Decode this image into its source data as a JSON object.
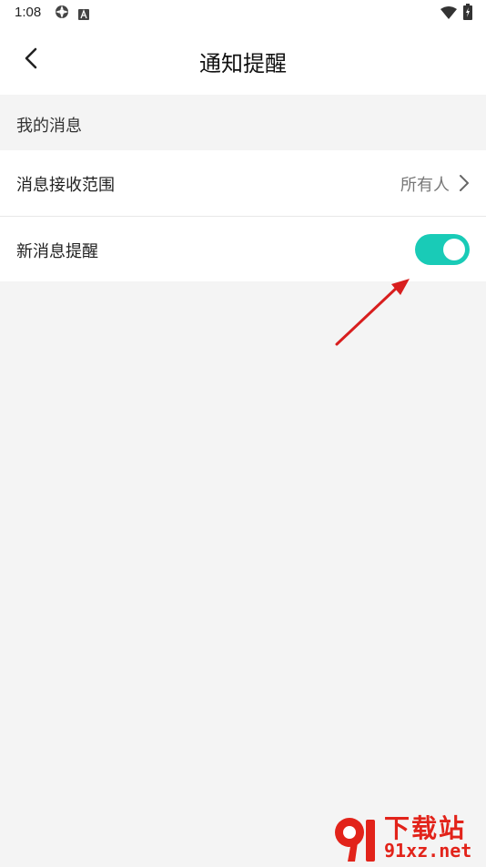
{
  "status_bar": {
    "time": "1:08",
    "icons": [
      "gear-icon",
      "font-icon",
      "wifi-icon",
      "battery-icon"
    ]
  },
  "header": {
    "title": "通知提醒",
    "back_icon": "chevron-left-icon"
  },
  "section": {
    "title": "我的消息"
  },
  "rows": [
    {
      "label": "消息接收范围",
      "value": "所有人",
      "icon": "chevron-right-icon"
    },
    {
      "label": "新消息提醒",
      "toggle_on": true
    }
  ],
  "colors": {
    "toggle_on": "#19cbb7",
    "background": "#f4f4f4",
    "annotation_arrow": "#d81e1e"
  },
  "watermark": {
    "logo_text": "91",
    "title": "下载站",
    "domain": "91xz.net"
  }
}
